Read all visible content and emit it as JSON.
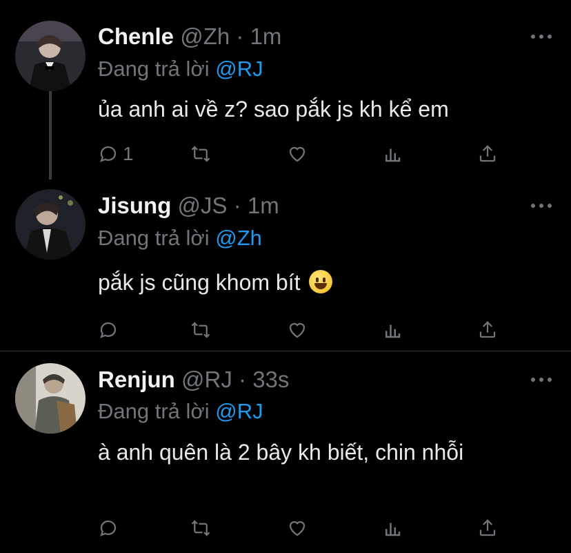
{
  "tweets": [
    {
      "name": "Chenle",
      "handle": "@Zh",
      "sep": "·",
      "time": "1m",
      "reply_prefix": "Đang trả lời",
      "reply_to": "@RJ",
      "text": "ủa anh ai về z? sao pắk js kh kể em",
      "reply_count": "1"
    },
    {
      "name": "Jisung",
      "handle": "@JS",
      "sep": "·",
      "time": "1m",
      "reply_prefix": "Đang trả lời",
      "reply_to": "@Zh",
      "text": "pắk js cũng khom bít",
      "emoji": "grinning-face",
      "reply_count": ""
    },
    {
      "name": "Renjun",
      "handle": "@RJ",
      "sep": "·",
      "time": "33s",
      "reply_prefix": "Đang trả lời",
      "reply_to": "@RJ",
      "text": "à anh quên là 2 bây kh biết, chin nhỗi",
      "reply_count": ""
    }
  ],
  "colors": {
    "background": "#000000",
    "text": "#e7e9ea",
    "muted": "#71767b",
    "accent": "#1d9bf0",
    "divider": "#2f3336"
  }
}
